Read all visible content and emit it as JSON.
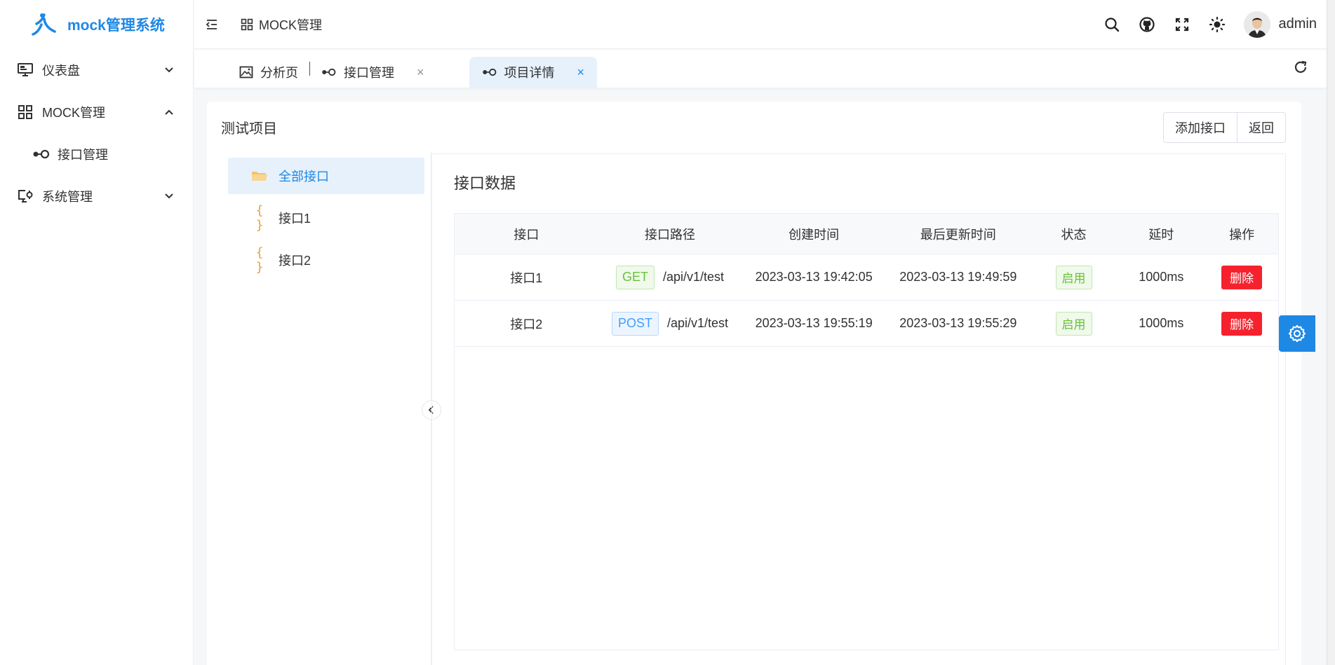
{
  "app": {
    "title": "mock管理系统"
  },
  "sidebar": {
    "items": [
      {
        "label": "仪表盘",
        "icon": "monitor-icon",
        "expanded": false
      },
      {
        "label": "MOCK管理",
        "icon": "grid-icon",
        "expanded": true,
        "children": [
          {
            "label": "接口管理",
            "icon": "api-link-icon"
          }
        ]
      },
      {
        "label": "系统管理",
        "icon": "system-settings-icon",
        "expanded": false
      }
    ]
  },
  "header": {
    "breadcrumb": "MOCK管理",
    "user": "admin"
  },
  "tabs": [
    {
      "label": "分析页",
      "icon": "image-icon",
      "closable": false
    },
    {
      "label": "接口管理",
      "icon": "api-link-icon",
      "closable": true
    },
    {
      "label": "项目详情",
      "icon": "api-link-icon",
      "closable": true,
      "active": true
    }
  ],
  "project": {
    "title": "测试项目",
    "add_label": "添加接口",
    "back_label": "返回"
  },
  "tree": [
    {
      "label": "全部接口",
      "icon": "folder-icon",
      "active": true
    },
    {
      "label": "接口1",
      "icon": "braces-icon"
    },
    {
      "label": "接口2",
      "icon": "braces-icon"
    }
  ],
  "panel": {
    "title": "接口数据"
  },
  "table": {
    "headers": [
      "接口",
      "接口路径",
      "创建时间",
      "最后更新时间",
      "状态",
      "延时",
      "操作"
    ],
    "rows": [
      {
        "name": "接口1",
        "method": "GET",
        "path": "/api/v1/test",
        "created": "2023-03-13 19:42:05",
        "updated": "2023-03-13 19:49:59",
        "status": "启用",
        "delay": "1000ms",
        "action": "删除"
      },
      {
        "name": "接口2",
        "method": "POST",
        "path": "/api/v1/test",
        "created": "2023-03-13 19:55:19",
        "updated": "2023-03-13 19:55:29",
        "status": "启用",
        "delay": "1000ms",
        "action": "删除"
      }
    ]
  },
  "colors": {
    "primary": "#1e88e5",
    "danger": "#f5222d",
    "success": "#67c23a"
  }
}
